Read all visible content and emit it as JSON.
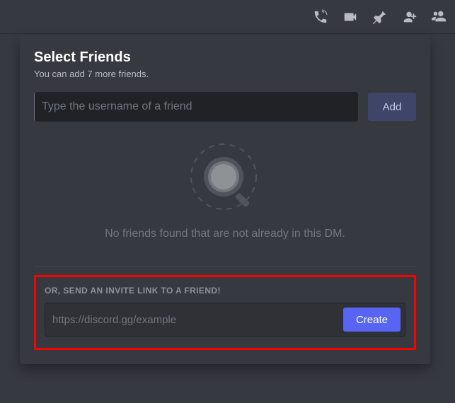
{
  "topbar": {
    "icons": [
      "call-icon",
      "video-icon",
      "pin-icon",
      "add-friend-icon",
      "members-icon"
    ]
  },
  "modal": {
    "title": "Select Friends",
    "subtitle": "You can add 7 more friends.",
    "search_placeholder": "Type the username of a friend",
    "add_label": "Add",
    "empty_text": "No friends found that are not already in this DM.",
    "invite_label": "OR, SEND AN INVITE LINK TO A FRIEND!",
    "invite_placeholder": "https://discord.gg/example",
    "create_label": "Create"
  },
  "colors": {
    "accent": "#5865f2",
    "highlight_border": "#ff0000"
  }
}
